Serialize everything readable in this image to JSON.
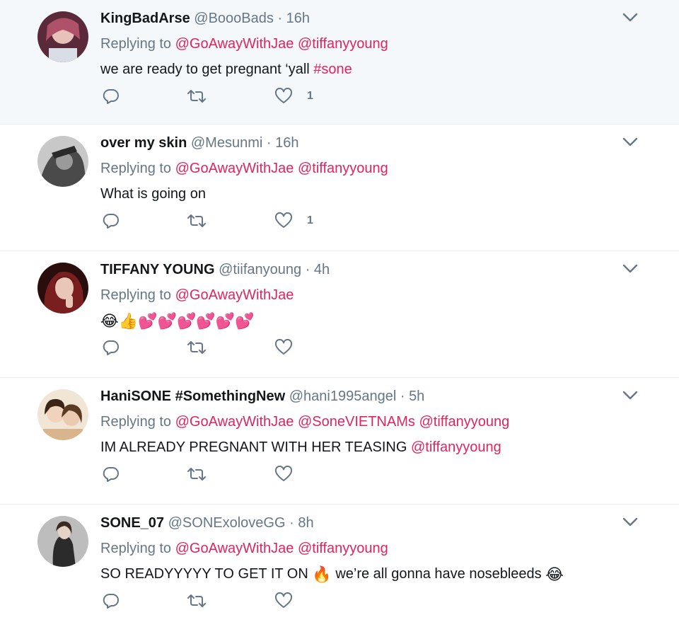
{
  "tweets": [
    {
      "name": "KingBadArse",
      "handle": "@BoooBads",
      "separator": "·",
      "time": "16h",
      "replying_label": "Replying to",
      "replying_to": [
        "@GoAwayWithJae",
        "@tiffanyyoung"
      ],
      "text_parts": [
        "we are ready to get pregnant ‘yall ",
        "#sone"
      ],
      "likes": "1",
      "avatar_color": "#b0516a"
    },
    {
      "name": "over my skin",
      "handle": "@Mesunmi",
      "separator": "·",
      "time": "16h",
      "replying_label": "Replying to",
      "replying_to": [
        "@GoAwayWithJae",
        "@tiffanyyoung"
      ],
      "text": "What is going on",
      "likes": "1",
      "avatar_color": "#9a9a9a"
    },
    {
      "name": "TIFFANY YOUNG",
      "handle": "@tiifanyoung",
      "separator": "·",
      "time": "4h",
      "replying_label": "Replying to",
      "replying_to": [
        "@GoAwayWithJae"
      ],
      "emoji": [
        "😂",
        "👍",
        "💕",
        "💕",
        "💕",
        "💕",
        "💕",
        "💕"
      ],
      "avatar_color": "#7a1f1f"
    },
    {
      "name": "HaniSONE #SomethingNew",
      "handle": "@hani1995angel",
      "separator": "·",
      "time": "5h",
      "replying_label": "Replying to",
      "replying_to": [
        "@GoAwayWithJae",
        "@SoneVIETNAMs",
        "@tiffanyyoung"
      ],
      "text_parts": [
        "IM ALREADY PREGNANT WITH HER TEASING ",
        "@tiffanyyoung"
      ],
      "avatar_color": "#d8b58c"
    },
    {
      "name": "SONE_07",
      "handle": "@SONExoloveGG",
      "separator": "·",
      "time": "8h",
      "replying_label": "Replying to",
      "replying_to": [
        "@GoAwayWithJae",
        "@tiffanyyoung"
      ],
      "text_a": "SO READYYYYY TO GET IT ON ",
      "emoji_fire": "🔥",
      "text_b": " we’re all gonna have nosebleeds ",
      "emoji_laugh": "😂",
      "avatar_color": "#6b6b6b"
    }
  ],
  "colors": {
    "link": "#e0245e",
    "secondary_text": "#657786",
    "highlight_bg": "#f5f8fa",
    "divider": "#e6ecf0"
  },
  "icons": [
    "reply-icon",
    "retweet-icon",
    "like-icon",
    "chevron-down-icon"
  ]
}
